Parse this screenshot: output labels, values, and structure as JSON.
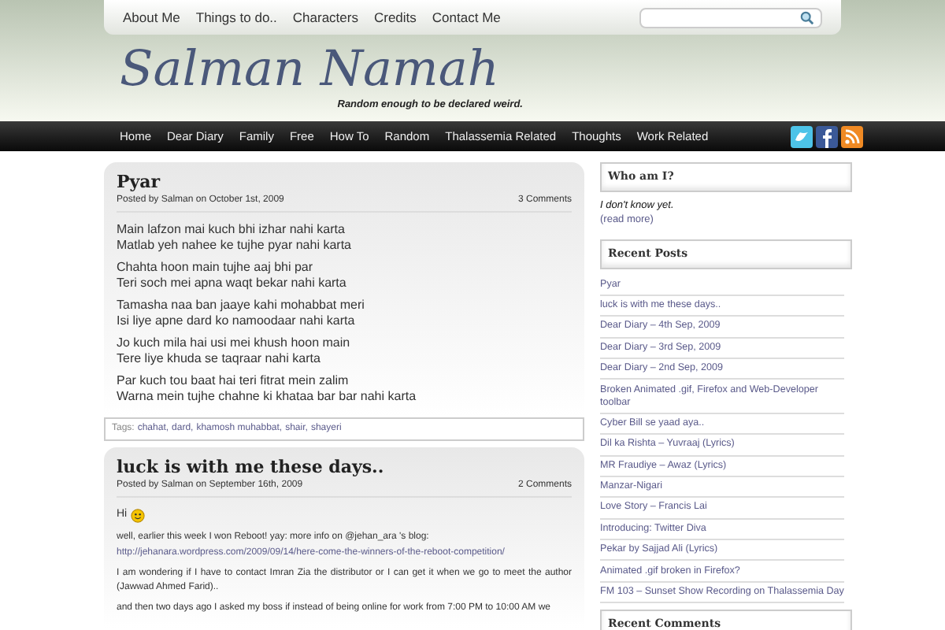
{
  "top_menu": [
    "About Me",
    "Things to do..",
    "Characters",
    "Credits",
    "Contact Me"
  ],
  "site": {
    "title": "Salman Namah",
    "tagline": "Random enough to be declared weird."
  },
  "categories": [
    "Home",
    "Dear Diary",
    "Family",
    "Free",
    "How To",
    "Random",
    "Thalassemia Related",
    "Thoughts",
    "Work Related"
  ],
  "posts": [
    {
      "title": "Pyar",
      "meta": "Posted by Salman on October 1st, 2009",
      "comments": "3 Comments",
      "stanzas": [
        [
          "Main lafzon mai kuch bhi izhar nahi karta",
          "Matlab yeh nahee ke tujhe pyar nahi karta"
        ],
        [
          "Chahta hoon main tujhe aaj bhi par",
          "Teri soch mei apna waqt bekar nahi karta"
        ],
        [
          "Tamasha naa ban jaaye kahi mohabbat meri",
          "Isi liye apne dard ko namoodaar nahi karta"
        ],
        [
          "Jo kuch mila hai usi mei khush hoon main",
          "Tere liye khuda se taqraar nahi karta"
        ],
        [
          "Par kuch tou baat hai teri fitrat mein zalim",
          "Warna mein tujhe chahne ki khataa bar bar nahi karta"
        ]
      ],
      "tags_label": "Tags:",
      "tags": [
        "chahat,",
        "dard,",
        "khamosh muhabbat,",
        "shair,",
        "shayeri"
      ]
    },
    {
      "title": "luck is with me these days..",
      "meta": "Posted by Salman on September 16th, 2009",
      "comments": "2 Comments",
      "greeting": "Hi",
      "paragraphs": [
        "well, earlier this week I won Reboot! yay: more info on @jehan_ara 's blog:",
        "I am wondering if I have to contact Imran Zia the distributor or I can get it when we go to meet the author (Jawwad Ahmed Farid)..",
        "and then two days ago I asked my boss if instead of being online for work from 7:00 PM to 10:00 AM we"
      ],
      "link": "http://jehanara.wordpress.com/2009/09/14/here-come-the-winners-of-the-reboot-competition/"
    }
  ],
  "sidebar": [
    {
      "title": "Who am I?",
      "text": "I don't know yet.",
      "more": "(read more)"
    },
    {
      "title": "Recent Posts",
      "items": [
        "Pyar",
        "luck is with me these days..",
        "Dear Diary – 4th Sep, 2009",
        "Dear Diary – 3rd Sep, 2009",
        "Dear Diary – 2nd Sep, 2009",
        "Broken Animated .gif, Firefox and Web-Developer toolbar",
        "Cyber Bill se yaad aya..",
        "Dil ka Rishta – Yuvraaj (Lyrics)",
        "MR Fraudiye – Awaz (Lyrics)",
        "Manzar-Nigari",
        "Love Story – Francis Lai",
        "Introducing: Twitter Diva",
        "Pekar by Sajjad Ali (Lyrics)",
        "Animated .gif broken in Firefox?",
        "FM 103 – Sunset Show Recording on Thalassemia Day"
      ]
    },
    {
      "title": "Recent Comments"
    }
  ]
}
